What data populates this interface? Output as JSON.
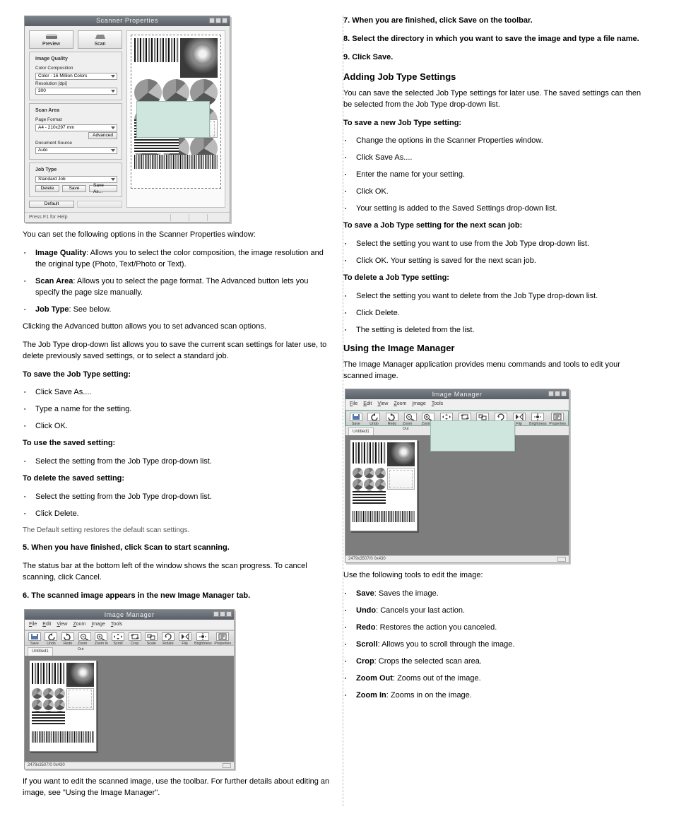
{
  "scanner_window": {
    "title": "Scanner Properties",
    "preview_btn": "Preview",
    "scan_btn": "Scan",
    "image_quality_legend": "Image Quality",
    "color_comp_label": "Color Composition",
    "color_comp_value": "Color - 16 Million Colors",
    "resolution_label": "Resolution [dpi]",
    "resolution_value": "300",
    "scan_area_legend": "Scan Area",
    "page_format_label": "Page Format",
    "page_format_value": "A4 - 210x297 mm",
    "advanced_btn": "Advanced",
    "doc_source_label": "Document Source",
    "doc_source_value": "Auto",
    "job_type_legend": "Job Type",
    "job_type_value": "Standard Job",
    "delete_btn": "Delete",
    "save_btn": "Save",
    "save_as_btn": "Save As...",
    "default_btn": "Default",
    "status": "Press F1 for Help"
  },
  "left_options_lead": "You can set the following options in the Scanner Properties window:",
  "options": {
    "iq": {
      "head": "Image Quality",
      "body": ": Allows you to select the color composition, the image resolution and the original type (Photo, Text/Photo or Text)."
    },
    "sa": {
      "head": "Scan Area",
      "body": ": Allows you to select the page format. The Advanced button lets you specify the page size manually."
    },
    "jt": {
      "head": "Job Type",
      "body": ": See below."
    }
  },
  "left_para1": "Clicking the Advanced button allows you to set advanced scan options.",
  "left_para2": "The Job Type drop-down list allows you to save the current scan settings for later use, to delete previously saved settings, or to select a standard job.",
  "left_save_head": "To save the Job Type setting:",
  "left_save_steps": [
    "Click Save As....",
    "Type a name for the setting.",
    "Click OK."
  ],
  "left_use_head": "To use the saved setting:",
  "left_use_steps": [
    "Select the setting from the Job Type drop-down list."
  ],
  "left_delete_head": "To delete the saved setting:",
  "left_delete_steps": [
    "Select the setting from the Job Type drop-down list.",
    "Click Delete."
  ],
  "left_note": "The Default setting restores the default scan settings.",
  "left_step5": "5. When you have finished, click Scan to start scanning.",
  "left_step5_more": "The status bar at the bottom left of the window shows the scan progress. To cancel scanning, click Cancel.",
  "left_step6": "6. The scanned image appears in the new Image Manager tab.",
  "im_window": {
    "title": "Image Manager",
    "menus": [
      "File",
      "Edit",
      "View",
      "Zoom",
      "Image",
      "Tools"
    ],
    "tools": [
      {
        "id": "save",
        "label": "Save"
      },
      {
        "id": "undo",
        "label": "Undo"
      },
      {
        "id": "redo",
        "label": "Redo"
      },
      {
        "id": "zoomout",
        "label": "Zoom Out"
      },
      {
        "id": "zoomin",
        "label": "Zoom In"
      },
      {
        "id": "scroll",
        "label": "Scroll"
      },
      {
        "id": "crop",
        "label": "Crop"
      },
      {
        "id": "scale",
        "label": "Scale"
      },
      {
        "id": "rotate",
        "label": "Rotate"
      },
      {
        "id": "flip",
        "label": "Flip"
      },
      {
        "id": "brightness",
        "label": "Brightness"
      },
      {
        "id": "properties",
        "label": "Properties"
      }
    ],
    "tab": "Untitled1",
    "status": "2479x3507/0 0x430"
  },
  "left_tail": "If you want to edit the scanned image, use the toolbar. For further details about editing an image, see \"Using the Image Manager\".",
  "step7": "7. When you are finished, click Save on the toolbar.",
  "step8": "8. Select the directory in which you want to save the image and type a file name.",
  "step9": "9. Click Save.",
  "right_heading": "Adding Job Type Settings",
  "right_para1": "You can save the selected Job Type settings for later use. The saved settings can then be selected from the Job Type drop-down list.",
  "right_save_head": "To save a new Job Type setting:",
  "right_save_steps": [
    "Change the options in the Scanner Properties window.",
    "Click Save As....",
    "Enter the name for your setting.",
    "Click OK.",
    "Your setting is added to the Saved Settings drop-down list."
  ],
  "right_next_head": "To save a Job Type setting for the next scan job:",
  "right_next_steps": [
    "Select the setting you want to use from the Job Type drop-down list.",
    "Click OK. Your setting is saved for the next scan job."
  ],
  "right_delete_head": "To delete a Job Type setting:",
  "right_delete_steps": [
    "Select the setting you want to delete from the Job Type drop-down list.",
    "Click Delete.",
    "The setting is deleted from the list."
  ],
  "right_im_heading": "Using the Image Manager",
  "right_im_lead": "The Image Manager application provides menu commands and tools to edit your scanned image.",
  "right_tools_lead": "Use the following tools to edit the image:",
  "tool_desc": [
    {
      "h": "Save",
      "b": "Saves the image."
    },
    {
      "h": "Undo",
      "b": "Cancels your last action."
    },
    {
      "h": "Redo",
      "b": "Restores the action you canceled."
    },
    {
      "h": "Scroll",
      "b": "Allows you to scroll through the image."
    },
    {
      "h": "Crop",
      "b": "Crops the selected scan area."
    },
    {
      "h": "Zoom Out",
      "b": "Zooms out of the image."
    },
    {
      "h": "Zoom In",
      "b": "Zooms in on the image."
    }
  ]
}
